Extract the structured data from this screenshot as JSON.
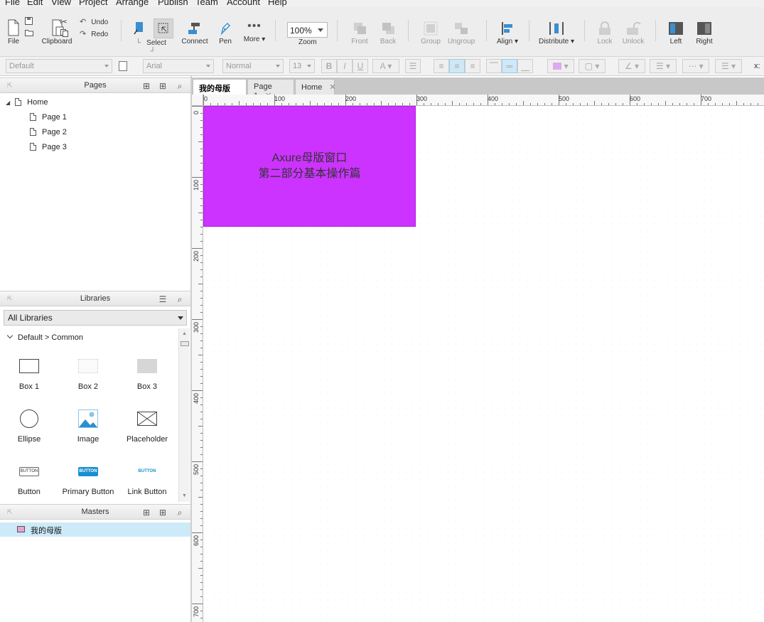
{
  "menu": [
    "File",
    "Edit",
    "View",
    "Project",
    "Arrange",
    "Publish",
    "Team",
    "Account",
    "Help"
  ],
  "toolbar": {
    "file": "File",
    "clipboard": "Clipboard",
    "undo": "Undo",
    "redo": "Redo",
    "select": "Select",
    "connect": "Connect",
    "pen": "Pen",
    "more": "More ▾",
    "zoom_value": "100%",
    "zoom": "Zoom",
    "front": "Front",
    "back": "Back",
    "group": "Group",
    "ungroup": "Ungroup",
    "align": "Align ▾",
    "distribute": "Distribute ▾",
    "lock": "Lock",
    "unlock": "Unlock",
    "left": "Left",
    "right": "Right"
  },
  "format": {
    "style": "Default",
    "font": "Arial",
    "weight": "Normal",
    "size": "13",
    "x_label": "x:"
  },
  "pages": {
    "title": "Pages",
    "items": [
      {
        "label": "Home",
        "level": 0
      },
      {
        "label": "Page 1",
        "level": 1
      },
      {
        "label": "Page 2",
        "level": 1
      },
      {
        "label": "Page 3",
        "level": 1
      }
    ]
  },
  "libraries": {
    "title": "Libraries",
    "selected": "All Libraries",
    "group": "Default > Common",
    "items": [
      {
        "label": "Box 1",
        "icon": "box1-icon"
      },
      {
        "label": "Box 2",
        "icon": "box2-icon"
      },
      {
        "label": "Box 3",
        "icon": "box3-icon"
      },
      {
        "label": "Ellipse",
        "icon": "ellipse-icon"
      },
      {
        "label": "Image",
        "icon": "image-icon"
      },
      {
        "label": "Placeholder",
        "icon": "placeholder-icon"
      },
      {
        "label": "Button",
        "icon": "button-icon"
      },
      {
        "label": "Primary Button",
        "icon": "primary-button-icon"
      },
      {
        "label": "Link Button",
        "icon": "link-button-icon"
      }
    ],
    "button_thumb_text": "BUTTON"
  },
  "masters": {
    "title": "Masters",
    "items": [
      {
        "label": "我的母版"
      }
    ]
  },
  "tabs": [
    {
      "label": "我的母版",
      "active": true
    },
    {
      "label": "Page 1",
      "active": false
    },
    {
      "label": "Home",
      "active": false
    }
  ],
  "ruler_h_labels": [
    "0",
    "100",
    "200",
    "300",
    "400",
    "500",
    "600",
    "700"
  ],
  "ruler_v_labels": [
    "0",
    "100",
    "200",
    "300",
    "400",
    "500",
    "600",
    "700"
  ],
  "canvas": {
    "master_line1": "Axure母版窗口",
    "master_line2": "第二部分基本操作篇",
    "master_color": "#cc33ff"
  }
}
